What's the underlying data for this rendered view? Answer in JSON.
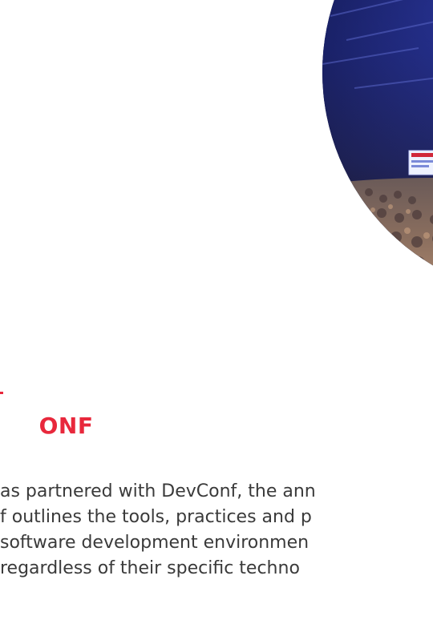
{
  "section": {
    "title_fragment": "ONF",
    "accent_color": "#e8283c",
    "text_color": "#3a3a3a"
  },
  "body": {
    "lines": [
      "as partnered with DevConf, the ann",
      "f outlines the tools, practices and p",
      "software development environmen",
      " regardless of their specific techno"
    ]
  },
  "photo": {
    "icon": "conference-audience-photo"
  }
}
